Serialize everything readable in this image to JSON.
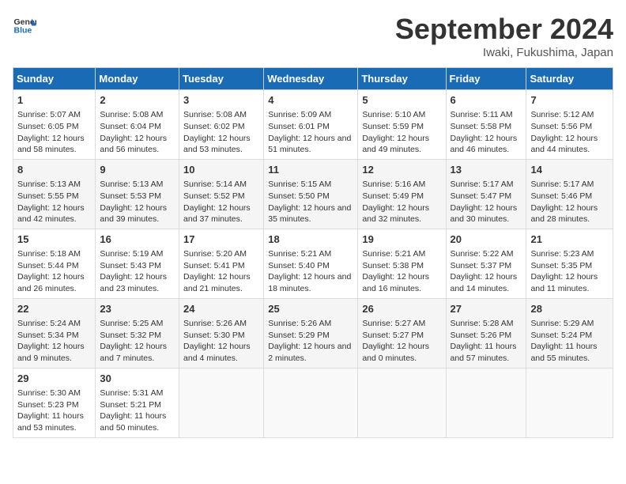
{
  "header": {
    "logo_general": "General",
    "logo_blue": "Blue",
    "title": "September 2024",
    "subtitle": "Iwaki, Fukushima, Japan"
  },
  "weekdays": [
    "Sunday",
    "Monday",
    "Tuesday",
    "Wednesday",
    "Thursday",
    "Friday",
    "Saturday"
  ],
  "weeks": [
    [
      {
        "day": "1",
        "sunrise": "5:07 AM",
        "sunset": "6:05 PM",
        "daylight": "12 hours and 58 minutes."
      },
      {
        "day": "2",
        "sunrise": "5:08 AM",
        "sunset": "6:04 PM",
        "daylight": "12 hours and 56 minutes."
      },
      {
        "day": "3",
        "sunrise": "5:08 AM",
        "sunset": "6:02 PM",
        "daylight": "12 hours and 53 minutes."
      },
      {
        "day": "4",
        "sunrise": "5:09 AM",
        "sunset": "6:01 PM",
        "daylight": "12 hours and 51 minutes."
      },
      {
        "day": "5",
        "sunrise": "5:10 AM",
        "sunset": "5:59 PM",
        "daylight": "12 hours and 49 minutes."
      },
      {
        "day": "6",
        "sunrise": "5:11 AM",
        "sunset": "5:58 PM",
        "daylight": "12 hours and 46 minutes."
      },
      {
        "day": "7",
        "sunrise": "5:12 AM",
        "sunset": "5:56 PM",
        "daylight": "12 hours and 44 minutes."
      }
    ],
    [
      {
        "day": "8",
        "sunrise": "5:13 AM",
        "sunset": "5:55 PM",
        "daylight": "12 hours and 42 minutes."
      },
      {
        "day": "9",
        "sunrise": "5:13 AM",
        "sunset": "5:53 PM",
        "daylight": "12 hours and 39 minutes."
      },
      {
        "day": "10",
        "sunrise": "5:14 AM",
        "sunset": "5:52 PM",
        "daylight": "12 hours and 37 minutes."
      },
      {
        "day": "11",
        "sunrise": "5:15 AM",
        "sunset": "5:50 PM",
        "daylight": "12 hours and 35 minutes."
      },
      {
        "day": "12",
        "sunrise": "5:16 AM",
        "sunset": "5:49 PM",
        "daylight": "12 hours and 32 minutes."
      },
      {
        "day": "13",
        "sunrise": "5:17 AM",
        "sunset": "5:47 PM",
        "daylight": "12 hours and 30 minutes."
      },
      {
        "day": "14",
        "sunrise": "5:17 AM",
        "sunset": "5:46 PM",
        "daylight": "12 hours and 28 minutes."
      }
    ],
    [
      {
        "day": "15",
        "sunrise": "5:18 AM",
        "sunset": "5:44 PM",
        "daylight": "12 hours and 26 minutes."
      },
      {
        "day": "16",
        "sunrise": "5:19 AM",
        "sunset": "5:43 PM",
        "daylight": "12 hours and 23 minutes."
      },
      {
        "day": "17",
        "sunrise": "5:20 AM",
        "sunset": "5:41 PM",
        "daylight": "12 hours and 21 minutes."
      },
      {
        "day": "18",
        "sunrise": "5:21 AM",
        "sunset": "5:40 PM",
        "daylight": "12 hours and 18 minutes."
      },
      {
        "day": "19",
        "sunrise": "5:21 AM",
        "sunset": "5:38 PM",
        "daylight": "12 hours and 16 minutes."
      },
      {
        "day": "20",
        "sunrise": "5:22 AM",
        "sunset": "5:37 PM",
        "daylight": "12 hours and 14 minutes."
      },
      {
        "day": "21",
        "sunrise": "5:23 AM",
        "sunset": "5:35 PM",
        "daylight": "12 hours and 11 minutes."
      }
    ],
    [
      {
        "day": "22",
        "sunrise": "5:24 AM",
        "sunset": "5:34 PM",
        "daylight": "12 hours and 9 minutes."
      },
      {
        "day": "23",
        "sunrise": "5:25 AM",
        "sunset": "5:32 PM",
        "daylight": "12 hours and 7 minutes."
      },
      {
        "day": "24",
        "sunrise": "5:26 AM",
        "sunset": "5:30 PM",
        "daylight": "12 hours and 4 minutes."
      },
      {
        "day": "25",
        "sunrise": "5:26 AM",
        "sunset": "5:29 PM",
        "daylight": "12 hours and 2 minutes."
      },
      {
        "day": "26",
        "sunrise": "5:27 AM",
        "sunset": "5:27 PM",
        "daylight": "12 hours and 0 minutes."
      },
      {
        "day": "27",
        "sunrise": "5:28 AM",
        "sunset": "5:26 PM",
        "daylight": "11 hours and 57 minutes."
      },
      {
        "day": "28",
        "sunrise": "5:29 AM",
        "sunset": "5:24 PM",
        "daylight": "11 hours and 55 minutes."
      }
    ],
    [
      {
        "day": "29",
        "sunrise": "5:30 AM",
        "sunset": "5:23 PM",
        "daylight": "11 hours and 53 minutes."
      },
      {
        "day": "30",
        "sunrise": "5:31 AM",
        "sunset": "5:21 PM",
        "daylight": "11 hours and 50 minutes."
      },
      null,
      null,
      null,
      null,
      null
    ]
  ]
}
